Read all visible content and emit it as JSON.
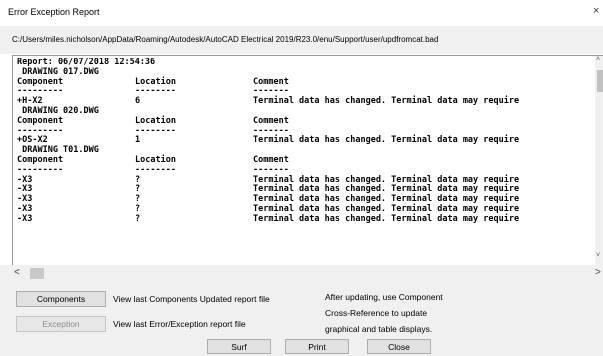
{
  "window": {
    "title": "Error Exception Report",
    "close_glyph": "×"
  },
  "path": "C:/Users/miles.nicholson/AppData/Roaming/Autodesk/AutoCAD Electrical 2019/R23.0/enu/Support/user/updfromcat.bad",
  "report": {
    "header": "Report: 06/07/2018 12:54:36",
    "column_headers": [
      "Component",
      "Location",
      "Comment"
    ],
    "separators": [
      "---------",
      "--------",
      "-------"
    ],
    "drawings": [
      {
        "name": " DRAWING 017.DWG",
        "rows": [
          {
            "component": "+H-X2",
            "location": "6",
            "comment": "Terminal data has changed. Terminal data may require"
          }
        ]
      },
      {
        "name": " DRAWING 020.DWG",
        "rows": [
          {
            "component": "+OS-X2",
            "location": "1",
            "comment": "Terminal data has changed. Terminal data may require"
          }
        ]
      },
      {
        "name": " DRAWING T01.DWG",
        "rows": [
          {
            "component": "-X3",
            "location": "?",
            "comment": "Terminal data has changed. Terminal data may require"
          },
          {
            "component": "-X3",
            "location": "?",
            "comment": "Terminal data has changed. Terminal data may require"
          },
          {
            "component": "-X3",
            "location": "?",
            "comment": "Terminal data has changed. Terminal data may require"
          },
          {
            "component": "-X3",
            "location": "?",
            "comment": "Terminal data has changed. Terminal data may require"
          },
          {
            "component": "-X3",
            "location": "?",
            "comment": "Terminal data has changed. Terminal data may require"
          }
        ]
      }
    ]
  },
  "buttons": {
    "components": "Components",
    "exception": "Exception",
    "surf": "Surf",
    "print": "Print",
    "close": "Close"
  },
  "labels": {
    "components_desc": "View last Components Updated report file",
    "exception_desc": "View last Error/Exception report file",
    "info_line1": "After updating, use Component",
    "info_line2": "Cross-Reference to update",
    "info_line3": "graphical and table displays."
  },
  "scroll": {
    "up_glyph": "˄",
    "down_glyph": "˅",
    "left_glyph": "<",
    "right_glyph": ">"
  }
}
